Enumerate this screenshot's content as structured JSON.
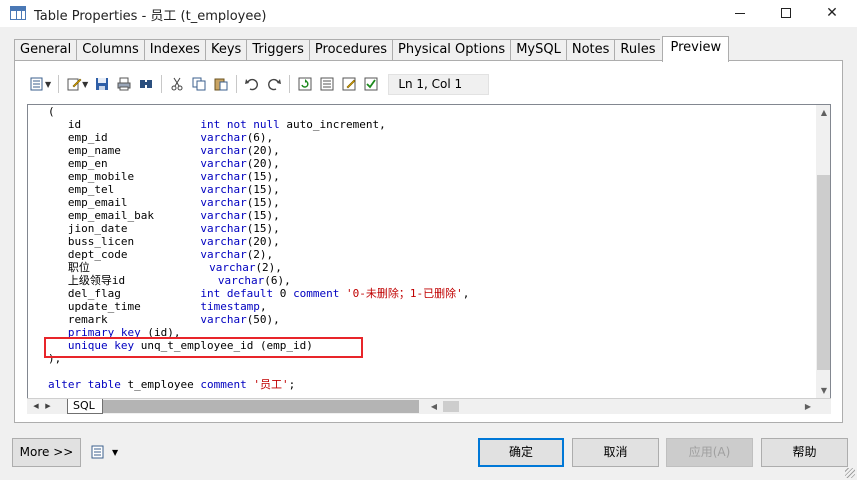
{
  "window": {
    "title": "Table Properties - 员工 (t_employee)",
    "minimize": "minimize",
    "maximize": "maximize",
    "close": "✕"
  },
  "tabs": [
    {
      "label": "General"
    },
    {
      "label": "Columns"
    },
    {
      "label": "Indexes"
    },
    {
      "label": "Keys"
    },
    {
      "label": "Triggers"
    },
    {
      "label": "Procedures"
    },
    {
      "label": "Physical Options"
    },
    {
      "label": "MySQL"
    },
    {
      "label": "Notes"
    },
    {
      "label": "Rules"
    },
    {
      "label": "Preview",
      "active": true
    }
  ],
  "toolbar": {
    "icons": [
      "properties-icon",
      "edit-icon",
      "save-icon",
      "print-icon",
      "find-icon",
      "cut-icon",
      "copy-icon",
      "paste-icon",
      "undo-icon",
      "redo-icon",
      "refresh-icon",
      "list-icon",
      "edit-properties-icon",
      "check-icon"
    ],
    "position": "Ln 1, Col 1"
  },
  "code": {
    "lines": [
      [
        {
          "t": "("
        }
      ],
      [
        {
          "t": "   id                  "
        },
        {
          "t": "int not null",
          "k": 1
        },
        {
          "t": " auto_increment,"
        }
      ],
      [
        {
          "t": "   emp_id              "
        },
        {
          "t": "varchar",
          "k": 1
        },
        {
          "t": "(6),"
        }
      ],
      [
        {
          "t": "   emp_name            "
        },
        {
          "t": "varchar",
          "k": 1
        },
        {
          "t": "(20),"
        }
      ],
      [
        {
          "t": "   emp_en              "
        },
        {
          "t": "varchar",
          "k": 1
        },
        {
          "t": "(20),"
        }
      ],
      [
        {
          "t": "   emp_mobile          "
        },
        {
          "t": "varchar",
          "k": 1
        },
        {
          "t": "(15),"
        }
      ],
      [
        {
          "t": "   emp_tel             "
        },
        {
          "t": "varchar",
          "k": 1
        },
        {
          "t": "(15),"
        }
      ],
      [
        {
          "t": "   emp_email           "
        },
        {
          "t": "varchar",
          "k": 1
        },
        {
          "t": "(15),"
        }
      ],
      [
        {
          "t": "   emp_email_bak       "
        },
        {
          "t": "varchar",
          "k": 1
        },
        {
          "t": "(15),"
        }
      ],
      [
        {
          "t": "   jion_date           "
        },
        {
          "t": "varchar",
          "k": 1
        },
        {
          "t": "(15),"
        }
      ],
      [
        {
          "t": "   buss_licen          "
        },
        {
          "t": "varchar",
          "k": 1
        },
        {
          "t": "(20),"
        }
      ],
      [
        {
          "t": "   dept_code           "
        },
        {
          "t": "varchar",
          "k": 1
        },
        {
          "t": "(2),"
        }
      ],
      [
        {
          "t": "   职位                  "
        },
        {
          "t": "varchar",
          "k": 1
        },
        {
          "t": "(2),"
        }
      ],
      [
        {
          "t": "   上级领导id              "
        },
        {
          "t": "varchar",
          "k": 1
        },
        {
          "t": "(6),"
        }
      ],
      [
        {
          "t": "   del_flag            "
        },
        {
          "t": "int default",
          "k": 1
        },
        {
          "t": " 0 "
        },
        {
          "t": "comment",
          "k": 1
        },
        {
          "t": " "
        },
        {
          "t": "'0-未删除；1-已删除'",
          "s": 1
        },
        {
          "t": ","
        }
      ],
      [
        {
          "t": "   update_time         "
        },
        {
          "t": "timestamp",
          "k": 1
        },
        {
          "t": ","
        }
      ],
      [
        {
          "t": "   remark              "
        },
        {
          "t": "varchar",
          "k": 1
        },
        {
          "t": "(50),"
        }
      ],
      [
        {
          "t": "   "
        },
        {
          "t": "primary key",
          "k": 1
        },
        {
          "t": " (id),"
        }
      ],
      [
        {
          "t": "   "
        },
        {
          "t": "unique key",
          "k": 1
        },
        {
          "t": " unq_t_employee_id (emp_id)"
        }
      ],
      [
        {
          "t": ");"
        }
      ],
      [
        {
          "t": ""
        }
      ],
      [
        {
          "t": "alter table",
          "k": 1
        },
        {
          "t": " t_employee "
        },
        {
          "t": "comment",
          "k": 1
        },
        {
          "t": " "
        },
        {
          "t": "'员工'",
          "s": 1
        },
        {
          "t": ";"
        }
      ]
    ]
  },
  "sheet_tab": "SQL",
  "buttons": {
    "more": "More >>",
    "ok": "确定",
    "cancel": "取消",
    "apply": "应用(A)",
    "help": "帮助"
  },
  "colors": {
    "keyword": "#0000c0",
    "string": "#c00000",
    "highlight_box": "#e8252a"
  }
}
